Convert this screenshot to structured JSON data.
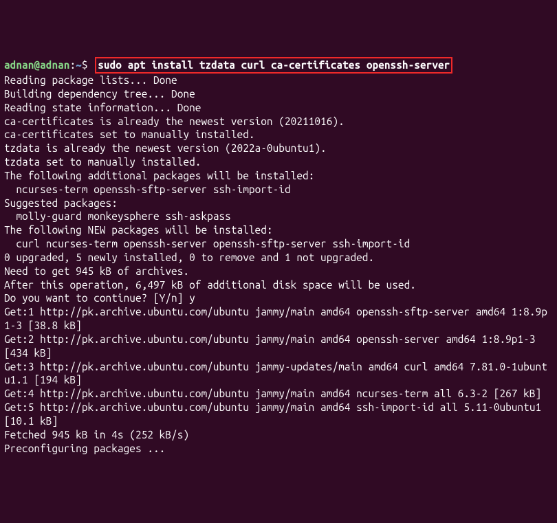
{
  "prompt": {
    "user_host": "adnan@adnan",
    "colon": ":",
    "tilde": "~",
    "dollar": "$"
  },
  "command": "sudo apt install tzdata curl ca-certificates openssh-server",
  "output_lines": [
    "Reading package lists... Done",
    "Building dependency tree... Done",
    "Reading state information... Done",
    "ca-certificates is already the newest version (20211016).",
    "ca-certificates set to manually installed.",
    "tzdata is already the newest version (2022a-0ubuntu1).",
    "tzdata set to manually installed.",
    "The following additional packages will be installed:",
    "  ncurses-term openssh-sftp-server ssh-import-id",
    "Suggested packages:",
    "  molly-guard monkeysphere ssh-askpass",
    "The following NEW packages will be installed:",
    "  curl ncurses-term openssh-server openssh-sftp-server ssh-import-id",
    "0 upgraded, 5 newly installed, 0 to remove and 1 not upgraded.",
    "Need to get 945 kB of archives.",
    "After this operation, 6,497 kB of additional disk space will be used.",
    "Do you want to continue? [Y/n] y",
    "Get:1 http://pk.archive.ubuntu.com/ubuntu jammy/main amd64 openssh-sftp-server amd64 1:8.9p1-3 [38.8 kB]",
    "Get:2 http://pk.archive.ubuntu.com/ubuntu jammy/main amd64 openssh-server amd64 1:8.9p1-3 [434 kB]",
    "Get:3 http://pk.archive.ubuntu.com/ubuntu jammy-updates/main amd64 curl amd64 7.81.0-1ubuntu1.1 [194 kB]",
    "Get:4 http://pk.archive.ubuntu.com/ubuntu jammy/main amd64 ncurses-term all 6.3-2 [267 kB]",
    "Get:5 http://pk.archive.ubuntu.com/ubuntu jammy/main amd64 ssh-import-id all 5.11-0ubuntu1 [10.1 kB]",
    "Fetched 945 kB in 4s (252 kB/s)",
    "Preconfiguring packages ..."
  ]
}
